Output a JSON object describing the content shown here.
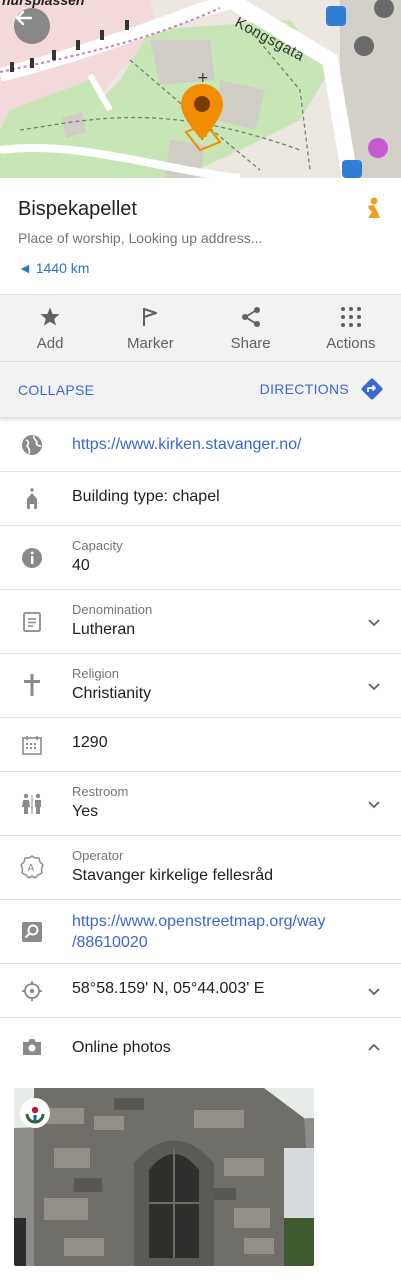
{
  "map": {
    "place_label": "nursplassen",
    "street_label": "Kongsgata"
  },
  "header": {
    "title": "Bispekapellet",
    "subtitle": "Place of worship, Looking up address...",
    "distance": "◄ 1440 km"
  },
  "actions": [
    {
      "label": "Add",
      "icon": "star-icon"
    },
    {
      "label": "Marker",
      "icon": "flag-icon"
    },
    {
      "label": "Share",
      "icon": "share-icon"
    },
    {
      "label": "Actions",
      "icon": "dots-grid-icon"
    }
  ],
  "bar": {
    "collapse": "COLLAPSE",
    "directions": "DIRECTIONS"
  },
  "details": {
    "website": "https://www.kirken.stavanger.no/",
    "building": "Building type: chapel",
    "capacity_label": "Capacity",
    "capacity_value": "40",
    "denomination_label": "Denomination",
    "denomination_value": "Lutheran",
    "religion_label": "Religion",
    "religion_value": "Christianity",
    "year": "1290",
    "restroom_label": "Restroom",
    "restroom_value": "Yes",
    "operator_label": "Operator",
    "operator_value": "Stavanger kirkelige fellesråd",
    "osm_link_line1": "https://www.openstreetmap.org/way",
    "osm_link_line2": "/88610020",
    "coordinates": "58°58.159' N, 05°44.003' E",
    "online_photos": "Online photos"
  },
  "colors": {
    "accent": "#3a66d6",
    "distance": "#2a78c8",
    "pin": "#f28c00"
  }
}
